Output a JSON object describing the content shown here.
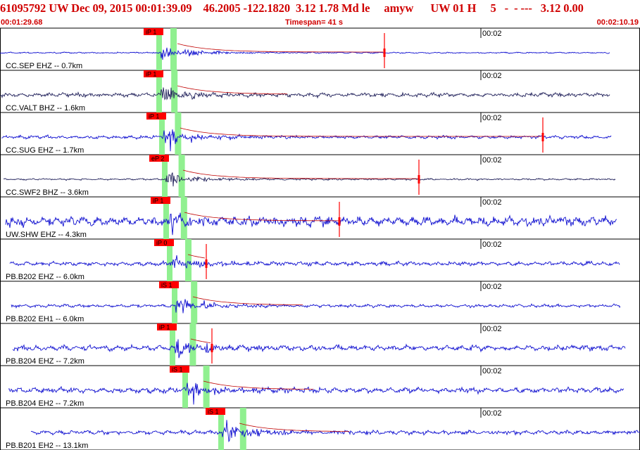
{
  "header": {
    "title": "61095792 UW Dec 09, 2015 00:01:39.09    46.2005 -122.1820  3.12 1.78 Md le     amyw      UW 01 H     5   -  - ---   3.12 0.00",
    "start_time": "00:01:29.68",
    "timespan": "Timespan=  41 s",
    "end_time": "00:02:10.19"
  },
  "colors": {
    "header_text": "#d00000",
    "trace_blue": "#1010d0",
    "trace_dark": "#20205a",
    "pick_box": "#ff0000",
    "phase_band": "#90f090",
    "coda_line": "#c00000"
  },
  "chart_data": {
    "type": "seismogram",
    "time_range": [
      "00:01:29.68",
      "00:02:10.19"
    ],
    "time_tick_label": "00:02",
    "channels": [
      {
        "label": "CC.SEP EHZ -- 0.7km",
        "pick": "iP 1",
        "color": "blue",
        "amp": 0.55,
        "noise": 0.04,
        "onset_px": 228,
        "spike_px": 546
      },
      {
        "label": "CC.VALT BHZ -- 1.6km",
        "pick": "iP 1",
        "color": "dark",
        "amp": 0.55,
        "noise": 0.12,
        "onset_px": 228,
        "spike_px": null
      },
      {
        "label": "CC.SUG EHZ -- 1.7km",
        "pick": "iP 1",
        "color": "blue",
        "amp": 0.6,
        "noise": 0.1,
        "onset_px": 232,
        "spike_px": 771
      },
      {
        "label": "CC.SWF2 BHZ -- 3.6km",
        "pick": "eP 2",
        "color": "dark",
        "amp": 0.45,
        "noise": 0.05,
        "onset_px": 236,
        "spike_px": 595
      },
      {
        "label": "UW.SHW EHZ -- 4.3km",
        "pick": "iP 1",
        "color": "blue",
        "amp": 0.6,
        "noise": 0.28,
        "onset_px": 238,
        "spike_px": 482
      },
      {
        "label": "PB.B202 EHZ -- 6.0km",
        "pick": "iP 0",
        "color": "blue",
        "amp": 0.35,
        "noise": 0.12,
        "onset_px": 243,
        "spike_px": 293
      },
      {
        "label": "PB.B202 EH1 -- 6.0km",
        "pick": "iS 1",
        "color": "blue",
        "amp": 0.55,
        "noise": 0.09,
        "onset_px": 250,
        "spike_px": null
      },
      {
        "label": "PB.B204 EHZ -- 7.2km",
        "pick": "iP 1",
        "color": "blue",
        "amp": 0.55,
        "noise": 0.16,
        "onset_px": 247,
        "spike_px": 301
      },
      {
        "label": "PB.B204 EH2 -- 7.2km",
        "pick": "iS 1",
        "color": "blue",
        "amp": 0.5,
        "noise": 0.16,
        "onset_px": 265,
        "spike_px": null
      },
      {
        "label": "PB.B201 EH2 -- 13.1km",
        "pick": "iS 1",
        "color": "blue",
        "amp": 0.7,
        "noise": 0.12,
        "onset_px": 316,
        "spike_px": null
      }
    ]
  }
}
